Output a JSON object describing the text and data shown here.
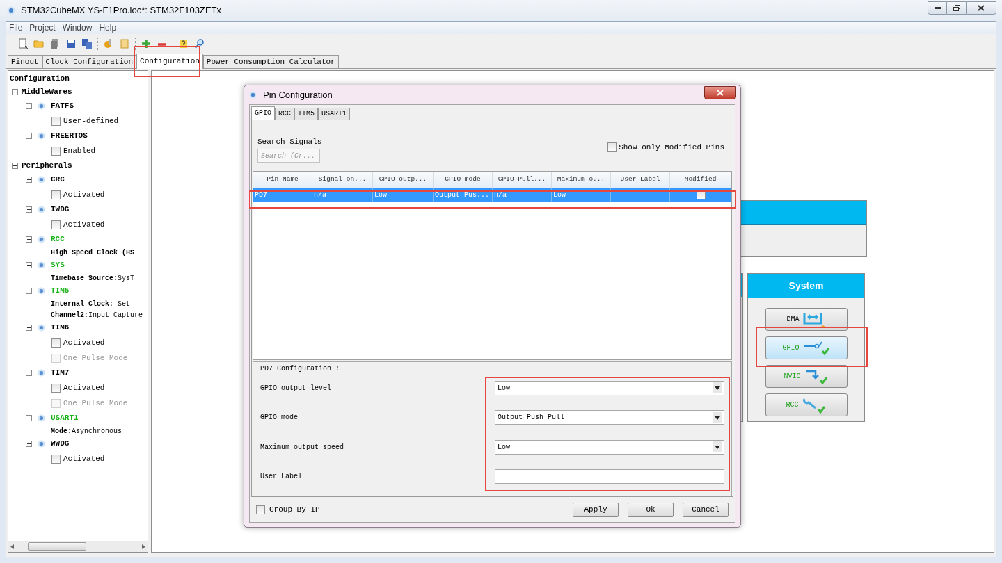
{
  "window": {
    "title": "STM32CubeMX YS-F1Pro.ioc*: STM32F103ZETx"
  },
  "menu": [
    "File",
    "Project",
    "Window",
    "Help"
  ],
  "tabs": [
    {
      "label": "Pinout",
      "selected": false
    },
    {
      "label": "Clock Configuration",
      "selected": false
    },
    {
      "label": "Configuration",
      "selected": true
    },
    {
      "label": "Power Consumption Calculator",
      "selected": false
    }
  ],
  "tree": {
    "label": "Configuration",
    "children": [
      {
        "kind": "group",
        "label": "MiddleWares",
        "expanded": true,
        "children": [
          {
            "kind": "peripheral",
            "label": "FATFS",
            "configured": false,
            "expanded": true,
            "children": [
              {
                "kind": "checkbox",
                "label": "User-defined",
                "checked": false,
                "disabled": false
              }
            ]
          },
          {
            "kind": "peripheral",
            "label": "FREERTOS",
            "configured": false,
            "expanded": true,
            "children": [
              {
                "kind": "checkbox",
                "label": "Enabled",
                "checked": false,
                "disabled": false
              }
            ]
          }
        ]
      },
      {
        "kind": "group",
        "label": "Peripherals",
        "expanded": true,
        "children": [
          {
            "kind": "peripheral",
            "label": "CRC",
            "configured": false,
            "expanded": true,
            "children": [
              {
                "kind": "checkbox",
                "label": "Activated",
                "checked": false,
                "disabled": false
              }
            ]
          },
          {
            "kind": "peripheral",
            "label": "IWDG",
            "configured": false,
            "expanded": true,
            "children": [
              {
                "kind": "checkbox",
                "label": "Activated",
                "checked": false,
                "disabled": false
              }
            ]
          },
          {
            "kind": "peripheral",
            "label": "RCC",
            "configured": true,
            "expanded": true,
            "children": [
              {
                "kind": "info",
                "label": "High Speed Clock (HS"
              }
            ]
          },
          {
            "kind": "peripheral",
            "label": "SYS",
            "configured": true,
            "expanded": true,
            "children": [
              {
                "kind": "info",
                "label": "Timebase Source",
                "value": ":SysT"
              }
            ]
          },
          {
            "kind": "peripheral",
            "label": "TIM5",
            "configured": true,
            "expanded": true,
            "children": [
              {
                "kind": "info",
                "label": "Internal Clock",
                "value": ": Set"
              },
              {
                "kind": "info",
                "label": "Channel2",
                "value": ":Input Capture"
              }
            ]
          },
          {
            "kind": "peripheral",
            "label": "TIM6",
            "configured": false,
            "expanded": true,
            "children": [
              {
                "kind": "checkbox",
                "label": "Activated",
                "checked": false,
                "disabled": false
              },
              {
                "kind": "checkbox",
                "label": "One Pulse Mode",
                "checked": false,
                "disabled": true
              }
            ]
          },
          {
            "kind": "peripheral",
            "label": "TIM7",
            "configured": false,
            "expanded": true,
            "children": [
              {
                "kind": "checkbox",
                "label": "Activated",
                "checked": false,
                "disabled": false
              },
              {
                "kind": "checkbox",
                "label": "One Pulse Mode",
                "checked": false,
                "disabled": true
              }
            ]
          },
          {
            "kind": "peripheral",
            "label": "USART1",
            "configured": true,
            "expanded": true,
            "children": [
              {
                "kind": "info",
                "label": "Mode",
                "value": ":Asynchronous"
              }
            ]
          },
          {
            "kind": "peripheral",
            "label": "WWDG",
            "configured": false,
            "expanded": true,
            "children": [
              {
                "kind": "checkbox",
                "label": "Activated",
                "checked": false,
                "disabled": false
              }
            ]
          }
        ]
      }
    ]
  },
  "system_panel": {
    "title": "System",
    "buttons": [
      {
        "label": "DMA",
        "configured": false,
        "selected": false
      },
      {
        "label": "GPIO",
        "configured": true,
        "selected": true
      },
      {
        "label": "NVIC",
        "configured": true,
        "selected": false
      },
      {
        "label": "RCC",
        "configured": true,
        "selected": false
      }
    ]
  },
  "dialog": {
    "title": "Pin Configuration",
    "tabs": [
      {
        "label": "GPIO",
        "selected": true
      },
      {
        "label": "RCC",
        "selected": false
      },
      {
        "label": "TIM5",
        "selected": false
      },
      {
        "label": "USART1",
        "selected": false
      }
    ],
    "search": {
      "label": "Search Signals",
      "placeholder": "Search (Cr..."
    },
    "show_modified": {
      "label": "Show only Modified Pins",
      "checked": false
    },
    "table": {
      "columns": [
        "Pin Name",
        "Signal on...",
        "GPIO outp...",
        "GPIO mode",
        "GPIO Pull...",
        "Maximum o...",
        "User Label",
        "Modified"
      ],
      "rows": [
        {
          "cells": [
            "PD7",
            "n/a",
            "Low",
            "Output Pus...",
            "n/a",
            "Low"
          ],
          "modified": false,
          "selected": true
        }
      ]
    },
    "config": {
      "title": "PD7 Configuration :",
      "fields": [
        {
          "kind": "select",
          "label": "GPIO output level",
          "value": "Low"
        },
        {
          "kind": "select",
          "label": "GPIO mode",
          "value": "Output Push Pull"
        },
        {
          "kind": "select",
          "label": "Maximum output speed",
          "value": "Low"
        },
        {
          "kind": "text",
          "label": "User Label"
        }
      ]
    },
    "group_by_ip": {
      "label": "Group By IP",
      "checked": false
    },
    "buttons": [
      "Apply",
      "Ok",
      "Cancel"
    ]
  }
}
